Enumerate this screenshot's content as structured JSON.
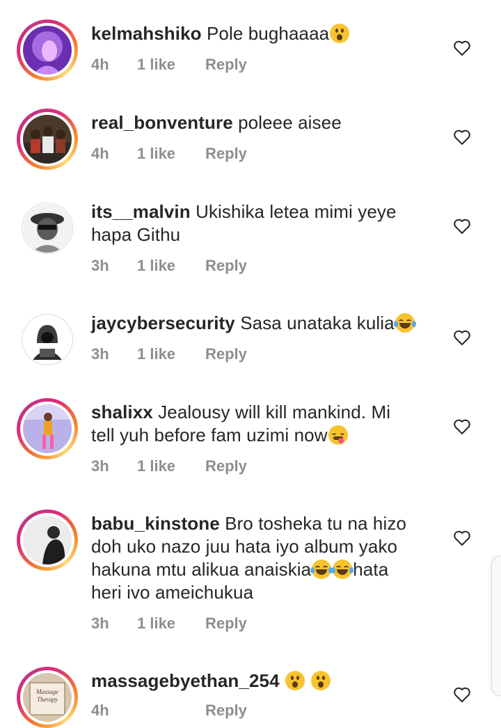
{
  "comments": [
    {
      "username": "kelmahshiko",
      "text": "Pole bughaaaa",
      "emoji_after": "astonished-emoji",
      "time": "4h",
      "likes": "1 like",
      "reply": "Reply"
    },
    {
      "username": "real_bonventure",
      "text": "poleee aisee",
      "time": "4h",
      "likes": "1 like",
      "reply": "Reply"
    },
    {
      "username": "its__malvin",
      "text": "Ukishika letea mimi yeye hapa Githu",
      "time": "3h",
      "likes": "1 like",
      "reply": "Reply"
    },
    {
      "username": "jaycybersecurity",
      "text": "Sasa unataka kulia",
      "emoji_after": "tears-of-joy-emoji",
      "time": "3h",
      "likes": "1 like",
      "reply": "Reply"
    },
    {
      "username": "shalixx",
      "text": "Jealousy will kill mankind. Mi tell yuh before fam uzimi now",
      "emoji_after": "drooling-emoji",
      "time": "3h",
      "likes": "1 like",
      "reply": "Reply"
    },
    {
      "username": "babu_kinstone",
      "text_part1": "Bro tosheka tu na hizo doh uko nazo juu hata iyo album yako hakuna mtu alikua anaiskia",
      "text_part2": "hata heri ivo ameichukua",
      "emoji_mid": "tears-of-joy-emoji",
      "time": "3h",
      "likes": "1 like",
      "reply": "Reply"
    },
    {
      "username": "massagebyethan_254",
      "text": "",
      "emoji_after": "astonished-emoji",
      "avatar_text": "Massage Therapy",
      "time": "4h",
      "likes": "",
      "reply": "Reply"
    }
  ],
  "colors": {
    "text": "#262626",
    "meta": "#8e8e8e",
    "ring_start": "#f58529",
    "ring_mid": "#dd2a7b",
    "ring_end": "#c13584"
  },
  "icons": {
    "like": "heart-outline-icon"
  }
}
